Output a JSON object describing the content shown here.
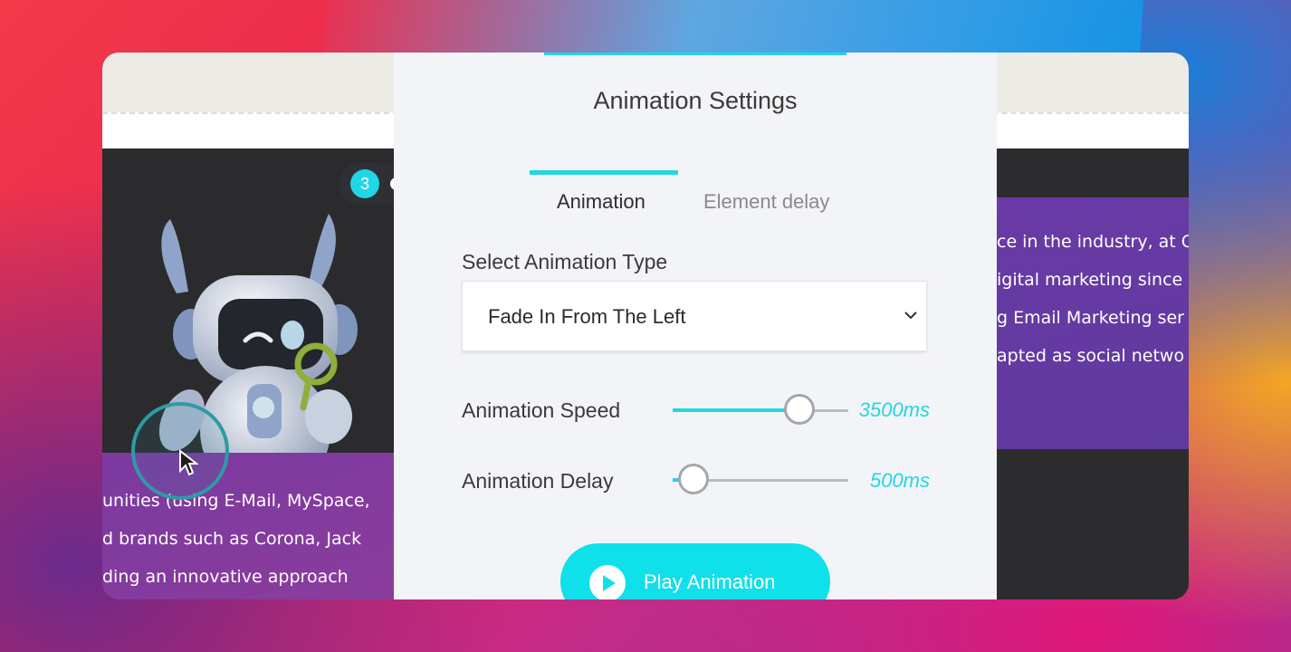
{
  "dialog": {
    "title": "Animation Settings",
    "tabs": [
      {
        "label": "Animation",
        "active": true
      },
      {
        "label": "Element delay",
        "active": false
      }
    ],
    "animation_type": {
      "label": "Select Animation Type",
      "selected": "Fade In From The Left"
    },
    "speed": {
      "label": "Animation Speed",
      "value_text": "3500ms",
      "fraction": 0.72
    },
    "delay": {
      "label": "Animation Delay",
      "value_text": "500ms",
      "fraction": 0.12
    },
    "play_button": {
      "label": "Play Animation",
      "icon": "play-icon"
    }
  },
  "background_page": {
    "badge_number": "3",
    "left_text_lines": [
      "unities (using E-Mail, MySpace,",
      "d brands such as Corona, Jack",
      "ding an innovative approach"
    ],
    "right_text_lines": [
      "ce in the industry, at C",
      "igital marketing since",
      "g Email Marketing ser",
      "apted as social netwo"
    ]
  },
  "colors": {
    "accent": "#22d6e6",
    "dialog_bg": "#f3f4f7",
    "card_purple": "#7a3aa0"
  }
}
